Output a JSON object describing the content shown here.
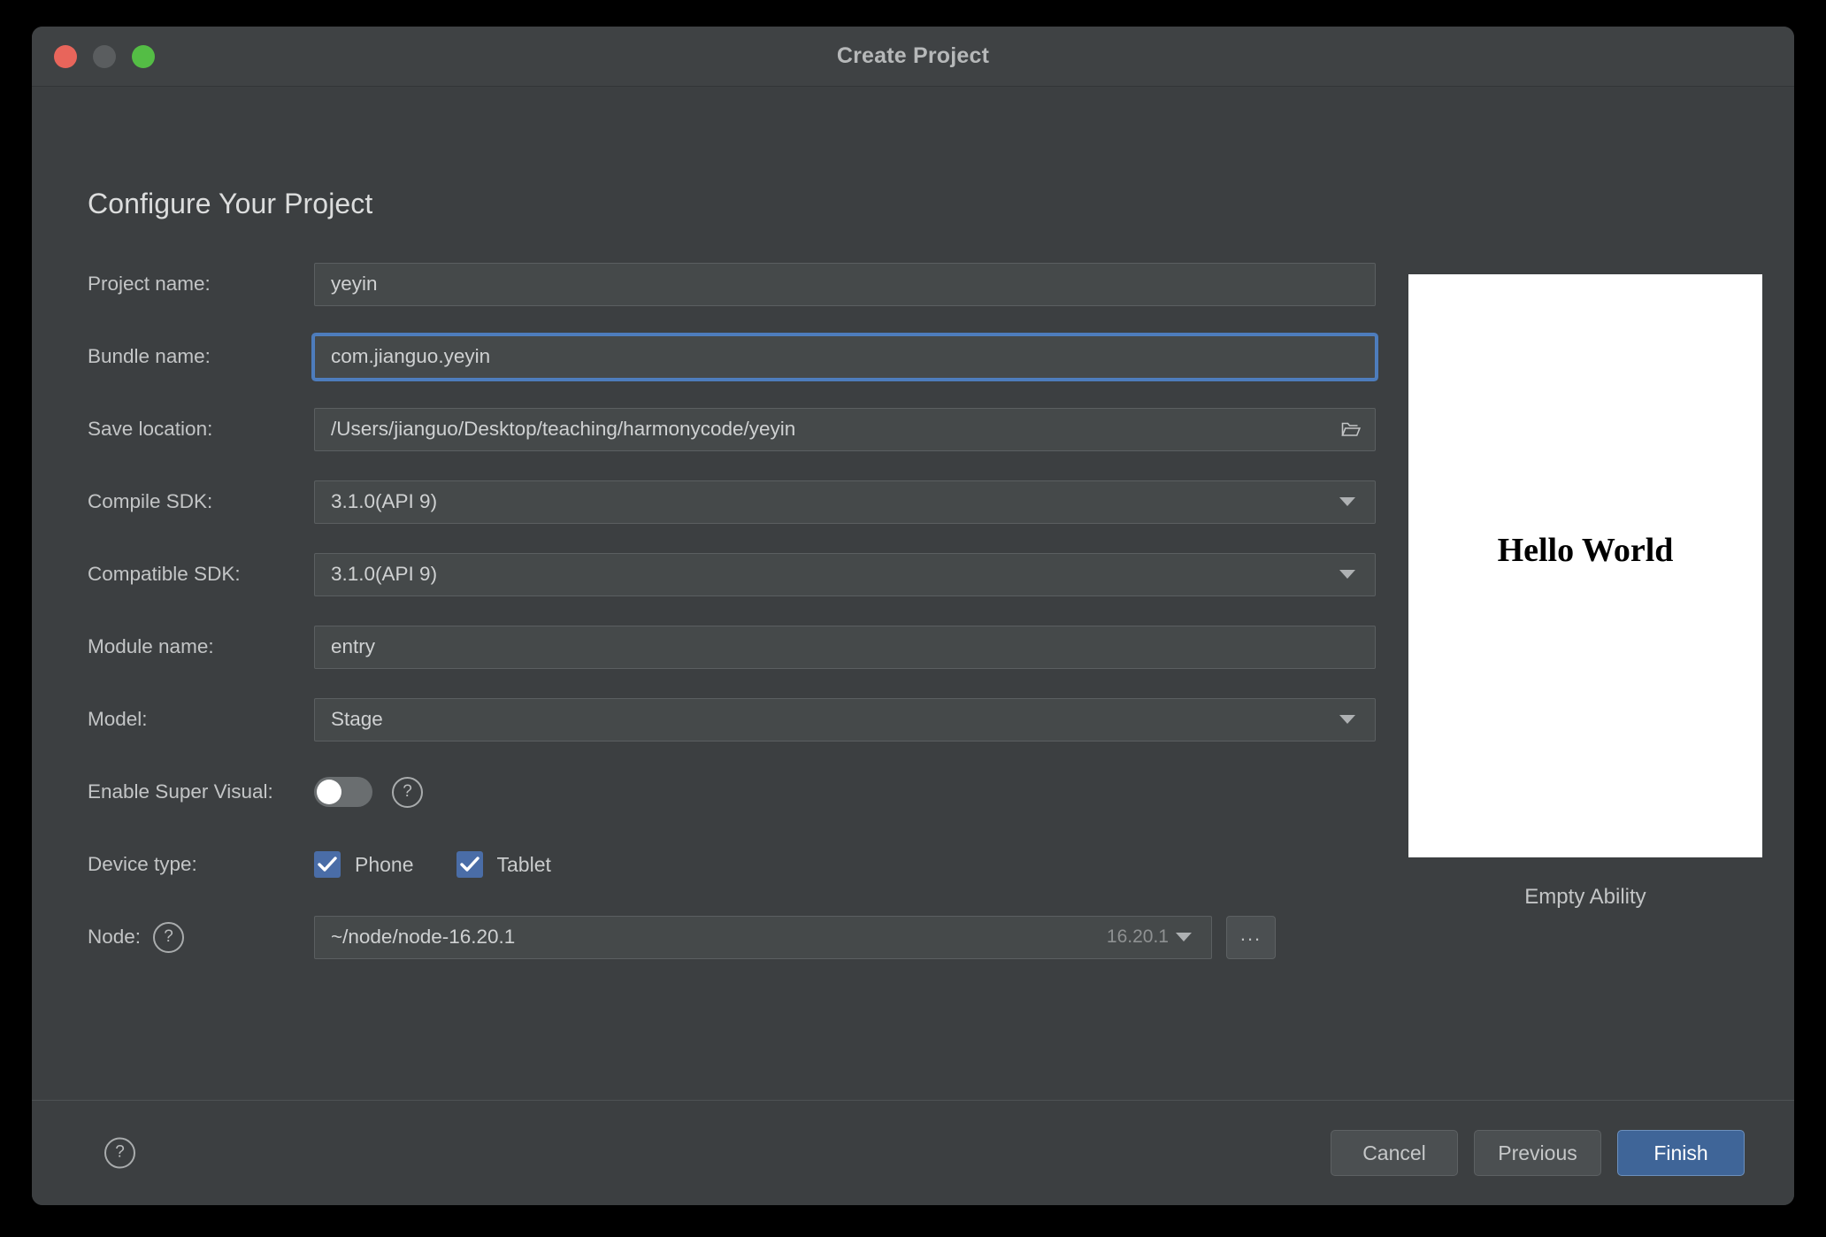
{
  "window": {
    "title": "Create Project",
    "traffic_lights": [
      "close-button",
      "minimize-button",
      "zoom-button"
    ]
  },
  "page_title": "Configure Your Project",
  "form": {
    "rows": [
      {
        "label": "Project name:",
        "value": "yeyin"
      },
      {
        "label": "Bundle name:",
        "value": "com.jianguo.yeyin"
      },
      {
        "label": "Save location:",
        "value": "/Users/jianguo/Desktop/teaching/harmonycode/yeyin"
      },
      {
        "label": "Compile SDK:",
        "value": "3.1.0(API 9)"
      },
      {
        "label": "Compatible SDK:",
        "value": "3.1.0(API 9)"
      },
      {
        "label": "Module name:",
        "value": "entry"
      },
      {
        "label": "Model:",
        "value": "Stage"
      },
      {
        "label": "Enable Super Visual:",
        "value": ""
      },
      {
        "label": "Device type:",
        "value": ""
      },
      {
        "label": "Node:",
        "value": "~/node/node-16.20.1"
      }
    ],
    "super_visual": {
      "state": "off"
    },
    "device_types": [
      {
        "label": "Phone",
        "checked": true
      },
      {
        "label": "Tablet",
        "checked": true
      }
    ],
    "node": {
      "path": "~/node/node-16.20.1",
      "version": "16.20.1",
      "browse_label": "..."
    }
  },
  "preview": {
    "screen_text": "Hello World",
    "caption": "Empty Ability"
  },
  "footer": {
    "help_glyph": "?",
    "buttons": [
      {
        "label": "Cancel",
        "style": "default"
      },
      {
        "label": "Previous",
        "style": "default"
      },
      {
        "label": "Finish",
        "style": "primary"
      }
    ]
  },
  "colors": {
    "dialog_bg": "#3c3f41",
    "input_bg": "#45494a",
    "accent_blue": "#4a6da7",
    "focus_blue": "#4d7cbc",
    "primary_button": "#3f6598"
  }
}
